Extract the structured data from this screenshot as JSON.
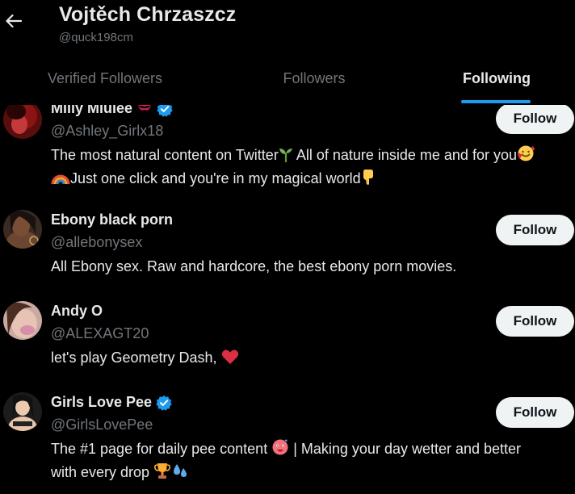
{
  "header": {
    "title": "Vojtěch Chrzaszcz",
    "handle": "@quck198cm",
    "back_icon": "arrow-left-icon"
  },
  "tabs": [
    {
      "label": "Verified Followers",
      "active": false
    },
    {
      "label": "Followers",
      "active": false
    },
    {
      "label": "Following",
      "active": true
    }
  ],
  "users": [
    {
      "name": "Milly Miulee",
      "name_emoji": "kiss-mark-icon",
      "verified": true,
      "handle": "@Ashley_Girlx18",
      "bio_line1_text_a": "The most natural content on Twitter",
      "bio_line1_text_b": " All of nature inside me and for you",
      "bio_line2_text": "Just one click and you're in my magical world",
      "bio_emojis": [
        "seedling-icon",
        "smiling-face-with-hearts-icon",
        "rainbow-icon",
        "pointing-down-icon"
      ],
      "follow_label": "Follow"
    },
    {
      "name": "Ebony black porn",
      "verified": false,
      "handle": "@allebonysex",
      "bio": "All Ebony sex. Raw and hardcore, the best ebony porn movies.",
      "follow_label": "Follow"
    },
    {
      "name": "Andy O",
      "verified": false,
      "handle": "@ALEXAGT20",
      "bio": "let's play Geometry Dash,",
      "bio_emoji": "red-heart-icon",
      "follow_label": "Follow"
    },
    {
      "name": "Girls Love Pee",
      "verified": true,
      "handle": "@GirlsLovePee",
      "bio_line1_a": "The #1 page for daily pee content",
      "bio_line1_b": " | Making your day wetter and better",
      "bio_line2": "with every drop",
      "bio_emojis": [
        "hot-face-icon",
        "trophy-icon",
        "droplets-icon"
      ],
      "follow_label": "Follow"
    }
  ],
  "colors": {
    "background": "#000000",
    "primary_text": "#e7e9ea",
    "secondary_text": "#71767b",
    "accent": "#1d9bf0",
    "button_bg": "#eff3f4",
    "button_text": "#0f1419"
  }
}
